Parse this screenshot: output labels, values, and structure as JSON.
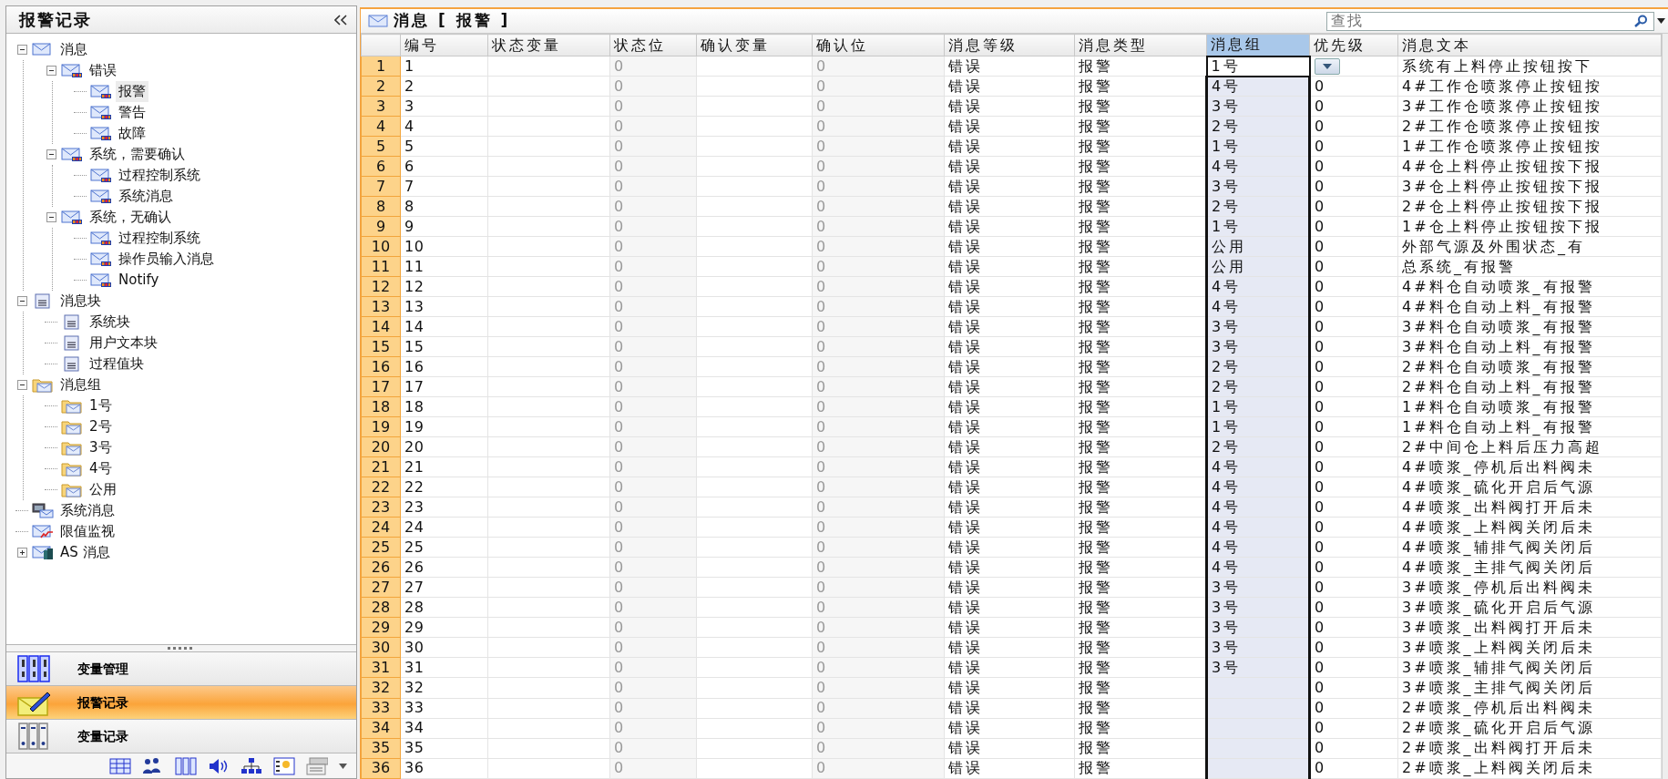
{
  "sidebar": {
    "title": "报警记录",
    "tree": [
      {
        "label": "消息",
        "kind": "mail",
        "expanded": true,
        "selected": false,
        "children": [
          {
            "label": "错误",
            "kind": "mail-alarm",
            "expanded": true,
            "selected": false,
            "children": [
              {
                "label": "报警",
                "kind": "mail-alarm",
                "selected": true
              },
              {
                "label": "警告",
                "kind": "mail-alarm",
                "selected": false
              },
              {
                "label": "故障",
                "kind": "mail-alarm",
                "selected": false
              }
            ]
          },
          {
            "label": "系统，需要确认",
            "kind": "mail-alarm",
            "expanded": true,
            "selected": false,
            "children": [
              {
                "label": "过程控制系统",
                "kind": "mail-alarm",
                "selected": false
              },
              {
                "label": "系统消息",
                "kind": "mail-alarm",
                "selected": false
              }
            ]
          },
          {
            "label": "系统，无确认",
            "kind": "mail-alarm",
            "expanded": true,
            "selected": false,
            "children": [
              {
                "label": "过程控制系统",
                "kind": "mail-alarm",
                "selected": false
              },
              {
                "label": "操作员输入消息",
                "kind": "mail-alarm",
                "selected": false
              },
              {
                "label": "Notify",
                "kind": "mail-alarm",
                "selected": false
              }
            ]
          }
        ]
      },
      {
        "label": "消息块",
        "kind": "block",
        "expanded": true,
        "selected": false,
        "children": [
          {
            "label": "系统块",
            "kind": "block",
            "selected": false
          },
          {
            "label": "用户文本块",
            "kind": "block",
            "selected": false
          },
          {
            "label": "过程值块",
            "kind": "block",
            "selected": false
          }
        ]
      },
      {
        "label": "消息组",
        "kind": "folder",
        "expanded": true,
        "selected": false,
        "children": [
          {
            "label": "1号",
            "kind": "folder",
            "selected": false
          },
          {
            "label": "2号",
            "kind": "folder",
            "selected": false
          },
          {
            "label": "3号",
            "kind": "folder",
            "selected": false
          },
          {
            "label": "4号",
            "kind": "folder",
            "selected": false
          },
          {
            "label": "公用",
            "kind": "folder",
            "selected": false
          }
        ]
      },
      {
        "label": "系统消息",
        "kind": "computer",
        "selected": false
      },
      {
        "label": "限值监视",
        "kind": "limit",
        "selected": false
      },
      {
        "label": "AS 消息",
        "kind": "device",
        "expanded": false,
        "selected": false
      }
    ],
    "nav": [
      {
        "label": "变量管理",
        "kind": "tags",
        "selected": false
      },
      {
        "label": "报警记录",
        "kind": "alarm",
        "selected": true
      },
      {
        "label": "变量记录",
        "kind": "binders",
        "selected": false
      }
    ]
  },
  "main": {
    "title": "消息 [ 报警 ]",
    "search": {
      "placeholder": "查找"
    },
    "table": {
      "columns": [
        {
          "label": "编号",
          "selected": false,
          "disabled": false
        },
        {
          "label": "状态变量",
          "selected": false,
          "disabled": false
        },
        {
          "label": "状态位",
          "selected": false,
          "disabled": true
        },
        {
          "label": "确认变量",
          "selected": false,
          "disabled": false
        },
        {
          "label": "确认位",
          "selected": false,
          "disabled": true
        },
        {
          "label": "消息等级",
          "selected": false,
          "disabled": false
        },
        {
          "label": "消息类型",
          "selected": false,
          "disabled": false
        },
        {
          "label": "消息组",
          "selected": true,
          "disabled": false
        },
        {
          "label": "优先级",
          "selected": false,
          "disabled": false
        },
        {
          "label": "消息文本",
          "selected": false,
          "disabled": false
        }
      ],
      "rows": [
        {
          "n": "1",
          "id": "1",
          "state_bit": "0",
          "ack_bit": "0",
          "level": "错误",
          "type": "报警",
          "group": "1号",
          "text": "系统有上料停止按钮按下",
          "current": true
        },
        {
          "n": "2",
          "id": "2",
          "state_bit": "0",
          "ack_bit": "0",
          "level": "错误",
          "type": "报警",
          "group": "4号",
          "priority": "0",
          "text": "4#工作仓喷浆停止按钮按",
          "current": false
        },
        {
          "n": "3",
          "id": "3",
          "state_bit": "0",
          "ack_bit": "0",
          "level": "错误",
          "type": "报警",
          "group": "3号",
          "priority": "0",
          "text": "3#工作仓喷浆停止按钮按",
          "current": false
        },
        {
          "n": "4",
          "id": "4",
          "state_bit": "0",
          "ack_bit": "0",
          "level": "错误",
          "type": "报警",
          "group": "2号",
          "priority": "0",
          "text": "2#工作仓喷浆停止按钮按",
          "current": false
        },
        {
          "n": "5",
          "id": "5",
          "state_bit": "0",
          "ack_bit": "0",
          "level": "错误",
          "type": "报警",
          "group": "1号",
          "priority": "0",
          "text": "1#工作仓喷浆停止按钮按",
          "current": false
        },
        {
          "n": "6",
          "id": "6",
          "state_bit": "0",
          "ack_bit": "0",
          "level": "错误",
          "type": "报警",
          "group": "4号",
          "priority": "0",
          "text": "4#仓上料停止按钮按下报",
          "current": false
        },
        {
          "n": "7",
          "id": "7",
          "state_bit": "0",
          "ack_bit": "0",
          "level": "错误",
          "type": "报警",
          "group": "3号",
          "priority": "0",
          "text": "3#仓上料停止按钮按下报",
          "current": false
        },
        {
          "n": "8",
          "id": "8",
          "state_bit": "0",
          "ack_bit": "0",
          "level": "错误",
          "type": "报警",
          "group": "2号",
          "priority": "0",
          "text": "2#仓上料停止按钮按下报",
          "current": false
        },
        {
          "n": "9",
          "id": "9",
          "state_bit": "0",
          "ack_bit": "0",
          "level": "错误",
          "type": "报警",
          "group": "1号",
          "priority": "0",
          "text": "1#仓上料停止按钮按下报",
          "current": false
        },
        {
          "n": "10",
          "id": "10",
          "state_bit": "0",
          "ack_bit": "0",
          "level": "错误",
          "type": "报警",
          "group": "公用",
          "priority": "0",
          "text": "外部气源及外围状态_有",
          "current": false
        },
        {
          "n": "11",
          "id": "11",
          "state_bit": "0",
          "ack_bit": "0",
          "level": "错误",
          "type": "报警",
          "group": "公用",
          "priority": "0",
          "text": "总系统_有报警",
          "current": false
        },
        {
          "n": "12",
          "id": "12",
          "state_bit": "0",
          "ack_bit": "0",
          "level": "错误",
          "type": "报警",
          "group": "4号",
          "priority": "0",
          "text": "4#料仓自动喷浆_有报警",
          "current": false
        },
        {
          "n": "13",
          "id": "13",
          "state_bit": "0",
          "ack_bit": "0",
          "level": "错误",
          "type": "报警",
          "group": "4号",
          "priority": "0",
          "text": "4#料仓自动上料_有报警",
          "current": false
        },
        {
          "n": "14",
          "id": "14",
          "state_bit": "0",
          "ack_bit": "0",
          "level": "错误",
          "type": "报警",
          "group": "3号",
          "priority": "0",
          "text": "3#料仓自动喷浆_有报警",
          "current": false
        },
        {
          "n": "15",
          "id": "15",
          "state_bit": "0",
          "ack_bit": "0",
          "level": "错误",
          "type": "报警",
          "group": "3号",
          "priority": "0",
          "text": "3#料仓自动上料_有报警",
          "current": false
        },
        {
          "n": "16",
          "id": "16",
          "state_bit": "0",
          "ack_bit": "0",
          "level": "错误",
          "type": "报警",
          "group": "2号",
          "priority": "0",
          "text": "2#料仓自动喷浆_有报警",
          "current": false
        },
        {
          "n": "17",
          "id": "17",
          "state_bit": "0",
          "ack_bit": "0",
          "level": "错误",
          "type": "报警",
          "group": "2号",
          "priority": "0",
          "text": "2#料仓自动上料_有报警",
          "current": false
        },
        {
          "n": "18",
          "id": "18",
          "state_bit": "0",
          "ack_bit": "0",
          "level": "错误",
          "type": "报警",
          "group": "1号",
          "priority": "0",
          "text": "1#料仓自动喷浆_有报警",
          "current": false
        },
        {
          "n": "19",
          "id": "19",
          "state_bit": "0",
          "ack_bit": "0",
          "level": "错误",
          "type": "报警",
          "group": "1号",
          "priority": "0",
          "text": "1#料仓自动上料_有报警",
          "current": false
        },
        {
          "n": "20",
          "id": "20",
          "state_bit": "0",
          "ack_bit": "0",
          "level": "错误",
          "type": "报警",
          "group": "2号",
          "priority": "0",
          "text": "2#中间仓上料后压力高超",
          "current": false
        },
        {
          "n": "21",
          "id": "21",
          "state_bit": "0",
          "ack_bit": "0",
          "level": "错误",
          "type": "报警",
          "group": "4号",
          "priority": "0",
          "text": "4#喷浆_停机后出料阀未",
          "current": false
        },
        {
          "n": "22",
          "id": "22",
          "state_bit": "0",
          "ack_bit": "0",
          "level": "错误",
          "type": "报警",
          "group": "4号",
          "priority": "0",
          "text": "4#喷浆_硫化开启后气源",
          "current": false
        },
        {
          "n": "23",
          "id": "23",
          "state_bit": "0",
          "ack_bit": "0",
          "level": "错误",
          "type": "报警",
          "group": "4号",
          "priority": "0",
          "text": "4#喷浆_出料阀打开后未",
          "current": false
        },
        {
          "n": "24",
          "id": "24",
          "state_bit": "0",
          "ack_bit": "0",
          "level": "错误",
          "type": "报警",
          "group": "4号",
          "priority": "0",
          "text": "4#喷浆_上料阀关闭后未",
          "current": false
        },
        {
          "n": "25",
          "id": "25",
          "state_bit": "0",
          "ack_bit": "0",
          "level": "错误",
          "type": "报警",
          "group": "4号",
          "priority": "0",
          "text": "4#喷浆_辅排气阀关闭后",
          "current": false
        },
        {
          "n": "26",
          "id": "26",
          "state_bit": "0",
          "ack_bit": "0",
          "level": "错误",
          "type": "报警",
          "group": "4号",
          "priority": "0",
          "text": "4#喷浆_主排气阀关闭后",
          "current": false
        },
        {
          "n": "27",
          "id": "27",
          "state_bit": "0",
          "ack_bit": "0",
          "level": "错误",
          "type": "报警",
          "group": "3号",
          "priority": "0",
          "text": "3#喷浆_停机后出料阀未",
          "current": false
        },
        {
          "n": "28",
          "id": "28",
          "state_bit": "0",
          "ack_bit": "0",
          "level": "错误",
          "type": "报警",
          "group": "3号",
          "priority": "0",
          "text": "3#喷浆_硫化开启后气源",
          "current": false
        },
        {
          "n": "29",
          "id": "29",
          "state_bit": "0",
          "ack_bit": "0",
          "level": "错误",
          "type": "报警",
          "group": "3号",
          "priority": "0",
          "text": "3#喷浆_出料阀打开后未",
          "current": false
        },
        {
          "n": "30",
          "id": "30",
          "state_bit": "0",
          "ack_bit": "0",
          "level": "错误",
          "type": "报警",
          "group": "3号",
          "priority": "0",
          "text": "3#喷浆_上料阀关闭后未",
          "current": false
        },
        {
          "n": "31",
          "id": "31",
          "state_bit": "0",
          "ack_bit": "0",
          "level": "错误",
          "type": "报警",
          "group": "3号",
          "priority": "0",
          "text": "3#喷浆_辅排气阀关闭后",
          "current": false
        },
        {
          "n": "32",
          "id": "32",
          "state_bit": "0",
          "ack_bit": "0",
          "level": "错误",
          "type": "报警",
          "priority": "0",
          "text": "3#喷浆_主排气阀关闭后",
          "current": false
        },
        {
          "n": "33",
          "id": "33",
          "state_bit": "0",
          "ack_bit": "0",
          "level": "错误",
          "type": "报警",
          "priority": "0",
          "text": "2#喷浆_停机后出料阀未",
          "current": false
        },
        {
          "n": "34",
          "id": "34",
          "state_bit": "0",
          "ack_bit": "0",
          "level": "错误",
          "type": "报警",
          "priority": "0",
          "text": "2#喷浆_硫化开启后气源",
          "current": false
        },
        {
          "n": "35",
          "id": "35",
          "state_bit": "0",
          "ack_bit": "0",
          "level": "错误",
          "type": "报警",
          "priority": "0",
          "text": "2#喷浆_出料阀打开后未",
          "current": false
        },
        {
          "n": "36",
          "id": "36",
          "state_bit": "0",
          "ack_bit": "0",
          "level": "错误",
          "type": "报警",
          "priority": "0",
          "text": "2#喷浆_上料阀关闭后未",
          "current": false
        }
      ]
    }
  }
}
